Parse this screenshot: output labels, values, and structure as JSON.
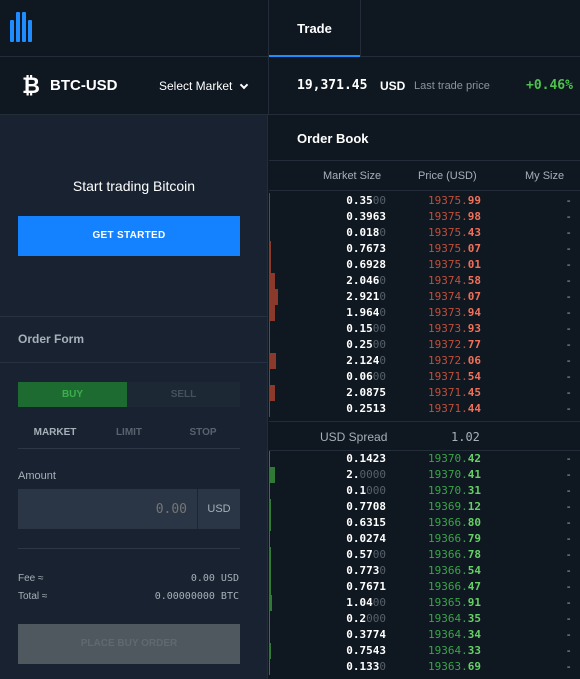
{
  "nav": {
    "tab_trade": "Trade"
  },
  "market": {
    "symbol_icon": "₿",
    "pair": "BTC-USD",
    "select_market_label": "Select Market",
    "last_price": "19,371.45",
    "last_price_currency": "USD",
    "last_price_label": "Last trade price",
    "change_24h": "+0.46%"
  },
  "left_panel": {
    "start_title": "Start trading Bitcoin",
    "get_started_label": "GET STARTED",
    "order_form_title": "Order Form",
    "buy_label": "BUY",
    "sell_label": "SELL",
    "order_types": [
      "MARKET",
      "LIMIT",
      "STOP"
    ],
    "amount_label": "Amount",
    "amount_value": "0.00",
    "amount_unit": "USD",
    "fee_label": "Fee ≈",
    "fee_value": "0.00 USD",
    "total_label": "Total ≈",
    "total_value": "0.00000000 BTC",
    "place_order_label": "PLACE BUY ORDER"
  },
  "order_book": {
    "title": "Order Book",
    "columns": {
      "size": "Market Size",
      "price": "Price (USD)",
      "mine": "My Size"
    },
    "asks": [
      {
        "size": "0.35",
        "size_pad": "00",
        "price": "19375.",
        "price_dec": "99",
        "mine": "-",
        "depth": 0.02
      },
      {
        "size": "0.3963",
        "size_pad": "",
        "price": "19375.",
        "price_dec": "98",
        "mine": "-",
        "depth": 0.02
      },
      {
        "size": "0.018",
        "size_pad": "0",
        "price": "19375.",
        "price_dec": "43",
        "mine": "-",
        "depth": 0.0
      },
      {
        "size": "0.7673",
        "size_pad": "",
        "price": "19375.",
        "price_dec": "07",
        "mine": "-",
        "depth": 0.04
      },
      {
        "size": "0.6928",
        "size_pad": "",
        "price": "19375.",
        "price_dec": "01",
        "mine": "-",
        "depth": 0.04
      },
      {
        "size": "2.046",
        "size_pad": "0",
        "price": "19374.",
        "price_dec": "58",
        "mine": "-",
        "depth": 0.11
      },
      {
        "size": "2.921",
        "size_pad": "0",
        "price": "19374.",
        "price_dec": "07",
        "mine": "-",
        "depth": 0.16
      },
      {
        "size": "1.964",
        "size_pad": "0",
        "price": "19373.",
        "price_dec": "94",
        "mine": "-",
        "depth": 0.11
      },
      {
        "size": "0.15",
        "size_pad": "00",
        "price": "19373.",
        "price_dec": "93",
        "mine": "-",
        "depth": 0.01
      },
      {
        "size": "0.25",
        "size_pad": "00",
        "price": "19372.",
        "price_dec": "77",
        "mine": "-",
        "depth": 0.01
      },
      {
        "size": "2.124",
        "size_pad": "0",
        "price": "19372.",
        "price_dec": "06",
        "mine": "-",
        "depth": 0.12
      },
      {
        "size": "0.06",
        "size_pad": "00",
        "price": "19371.",
        "price_dec": "54",
        "mine": "-",
        "depth": 0.0
      },
      {
        "size": "2.0875",
        "size_pad": "",
        "price": "19371.",
        "price_dec": "45",
        "mine": "-",
        "depth": 0.11
      },
      {
        "size": "0.2513",
        "size_pad": "",
        "price": "19371.",
        "price_dec": "44",
        "mine": "-",
        "depth": 0.01
      }
    ],
    "spread_label": "USD Spread",
    "spread_value": "1.02",
    "bids": [
      {
        "size": "0.1423",
        "size_pad": "",
        "price": "19370.",
        "price_dec": "42",
        "mine": "-",
        "depth": 0.02
      },
      {
        "size": "2.",
        "size_pad": "0000",
        "price": "19370.",
        "price_dec": "41",
        "mine": "-",
        "depth": 0.11
      },
      {
        "size": "0.1",
        "size_pad": "000",
        "price": "19370.",
        "price_dec": "31",
        "mine": "-",
        "depth": 0.01
      },
      {
        "size": "0.7708",
        "size_pad": "",
        "price": "19369.",
        "price_dec": "12",
        "mine": "-",
        "depth": 0.04
      },
      {
        "size": "0.6315",
        "size_pad": "",
        "price": "19366.",
        "price_dec": "80",
        "mine": "-",
        "depth": 0.03
      },
      {
        "size": "0.0274",
        "size_pad": "",
        "price": "19366.",
        "price_dec": "79",
        "mine": "-",
        "depth": 0.0
      },
      {
        "size": "0.57",
        "size_pad": "00",
        "price": "19366.",
        "price_dec": "78",
        "mine": "-",
        "depth": 0.03
      },
      {
        "size": "0.773",
        "size_pad": "0",
        "price": "19366.",
        "price_dec": "54",
        "mine": "-",
        "depth": 0.04
      },
      {
        "size": "0.7671",
        "size_pad": "",
        "price": "19366.",
        "price_dec": "47",
        "mine": "-",
        "depth": 0.04
      },
      {
        "size": "1.04",
        "size_pad": "00",
        "price": "19365.",
        "price_dec": "91",
        "mine": "-",
        "depth": 0.05
      },
      {
        "size": "0.2",
        "size_pad": "000",
        "price": "19364.",
        "price_dec": "35",
        "mine": "-",
        "depth": 0.01
      },
      {
        "size": "0.3774",
        "size_pad": "",
        "price": "19364.",
        "price_dec": "34",
        "mine": "-",
        "depth": 0.02
      },
      {
        "size": "0.7543",
        "size_pad": "",
        "price": "19364.",
        "price_dec": "33",
        "mine": "-",
        "depth": 0.04
      },
      {
        "size": "0.133",
        "size_pad": "0",
        "price": "19363.",
        "price_dec": "69",
        "mine": "-",
        "depth": 0.01
      }
    ]
  },
  "colors": {
    "accent": "#1482ff",
    "ask": "#f0715a",
    "bid": "#67d067",
    "change_positive": "#4cc44c",
    "ask_depth": "#8a3a2a",
    "bid_depth": "#2f7a34"
  },
  "icons": {
    "logo": "exchange-logo-icon",
    "bitcoin": "bitcoin-icon",
    "select_market": "chevron-down-icon"
  }
}
